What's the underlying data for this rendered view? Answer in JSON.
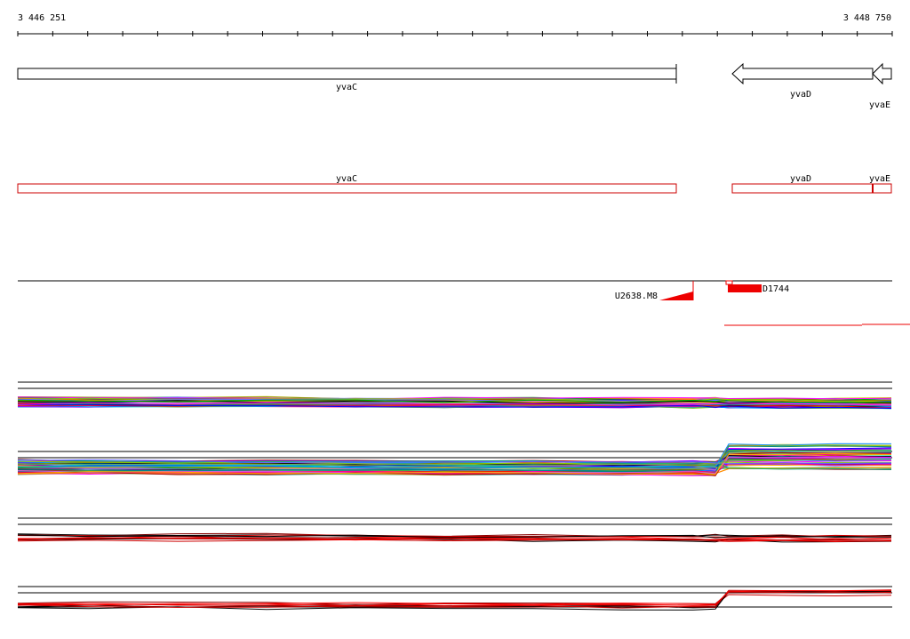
{
  "ruler": {
    "start_label": "3 446 251",
    "end_label": "3 448 750",
    "start": 3446251,
    "end": 3448750
  },
  "genes": [
    {
      "name": "yvaC",
      "start": 3446251,
      "end": 3448135,
      "strand": "+"
    },
    {
      "name": "yvaD",
      "start": 3448295,
      "end": 3448695,
      "strand": "-"
    },
    {
      "name": "yvaE",
      "start": 3448695,
      "end": 3448750,
      "strand": "-"
    }
  ],
  "transcripts": [
    {
      "name": "yvaC",
      "start": 3446251,
      "end": 3448135
    },
    {
      "name": "yvaD",
      "start": 3448295,
      "end": 3448695
    },
    {
      "name": "yvaE",
      "start": 3448695,
      "end": 3448750
    }
  ],
  "features": [
    {
      "label": "U2638.M8",
      "kind": "wedge-left",
      "position": 3448190
    },
    {
      "label": "D1744",
      "kind": "block",
      "start": 3448295,
      "end": 3448395
    }
  ],
  "colors": {
    "gene_outline": "#000000",
    "transcript_outline": "#cc0000",
    "feature_fill": "#ee0000",
    "track_frame": "#000000"
  }
}
